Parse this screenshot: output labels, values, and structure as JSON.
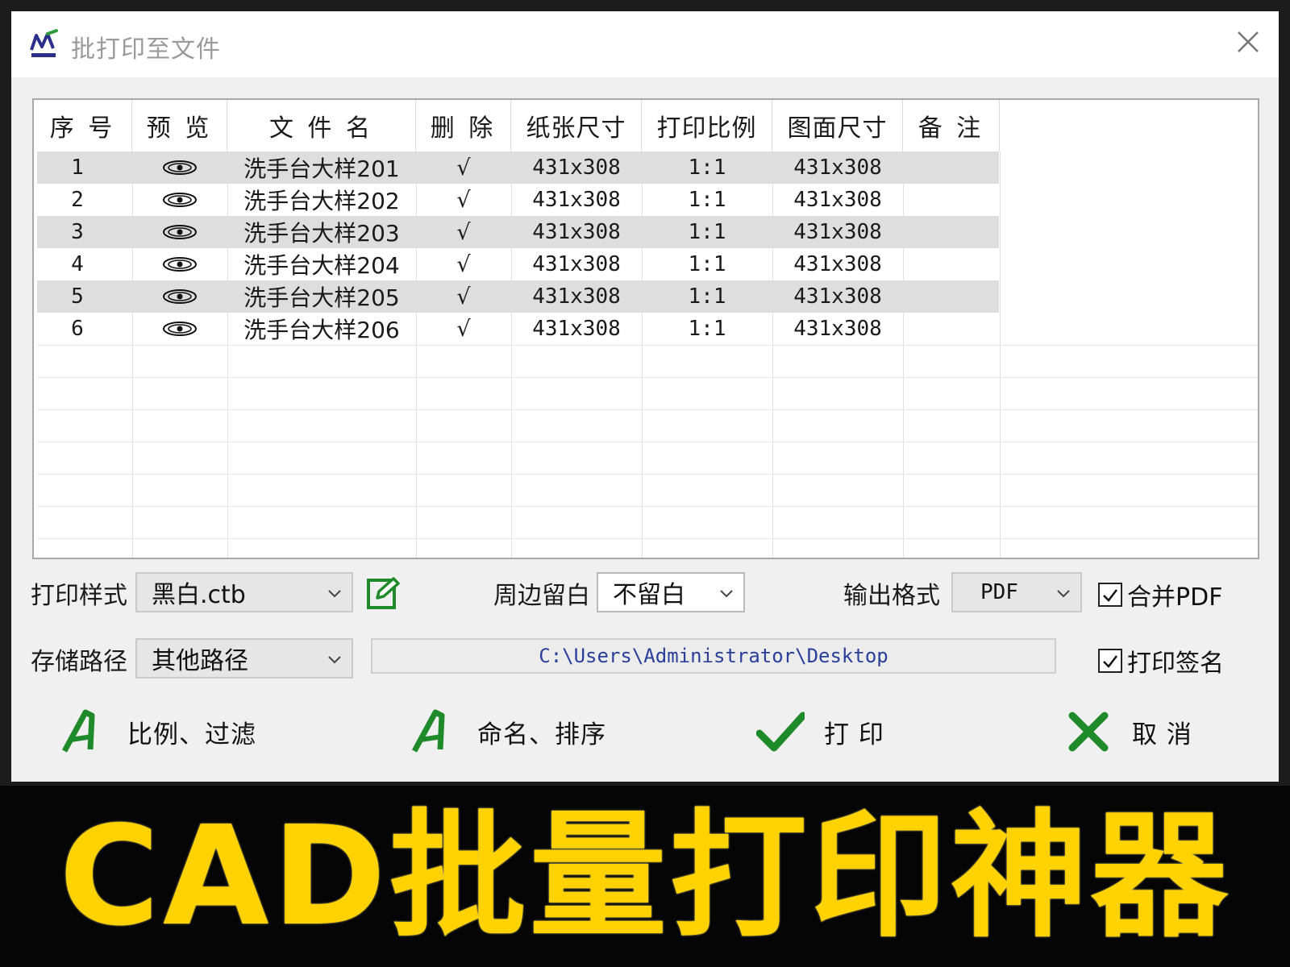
{
  "window": {
    "title": "批打印至文件"
  },
  "table": {
    "columns": [
      "序 号",
      "预 览",
      "文 件 名",
      "删 除",
      "纸张尺寸",
      "打印比例",
      "图面尺寸",
      "备 注"
    ],
    "rows": [
      {
        "index": "1",
        "name": "洗手台大样201",
        "delete": "√",
        "paper": "431x308",
        "scale": "1:1",
        "drawing": "431x308",
        "note": ""
      },
      {
        "index": "2",
        "name": "洗手台大样202",
        "delete": "√",
        "paper": "431x308",
        "scale": "1:1",
        "drawing": "431x308",
        "note": ""
      },
      {
        "index": "3",
        "name": "洗手台大样203",
        "delete": "√",
        "paper": "431x308",
        "scale": "1:1",
        "drawing": "431x308",
        "note": ""
      },
      {
        "index": "4",
        "name": "洗手台大样204",
        "delete": "√",
        "paper": "431x308",
        "scale": "1:1",
        "drawing": "431x308",
        "note": ""
      },
      {
        "index": "5",
        "name": "洗手台大样205",
        "delete": "√",
        "paper": "431x308",
        "scale": "1:1",
        "drawing": "431x308",
        "note": ""
      },
      {
        "index": "6",
        "name": "洗手台大样206",
        "delete": "√",
        "paper": "431x308",
        "scale": "1:1",
        "drawing": "431x308",
        "note": ""
      }
    ]
  },
  "options": {
    "print_style_label": "打印样式",
    "print_style_value": "黑白.ctb",
    "margin_label": "周边留白",
    "margin_value": "不留白",
    "output_format_label": "输出格式",
    "output_format_value": "PDF",
    "merge_pdf_label": "合并PDF",
    "merge_pdf_checked": true,
    "save_path_label": "存储路径",
    "save_path_value": "其他路径",
    "path": "C:\\Users\\Administrator\\Desktop",
    "print_signature_label": "打印签名",
    "print_signature_checked": true
  },
  "actions": {
    "scale_filter": "比例、过滤",
    "name_sort": "命名、排序",
    "print": "打 印",
    "cancel": "取 消"
  },
  "banner": {
    "text": "CAD批量打印神器"
  },
  "colors": {
    "accent_green": "#1f8a2a",
    "banner_yellow": "#ffd200",
    "path_blue": "#2a3f9a"
  }
}
